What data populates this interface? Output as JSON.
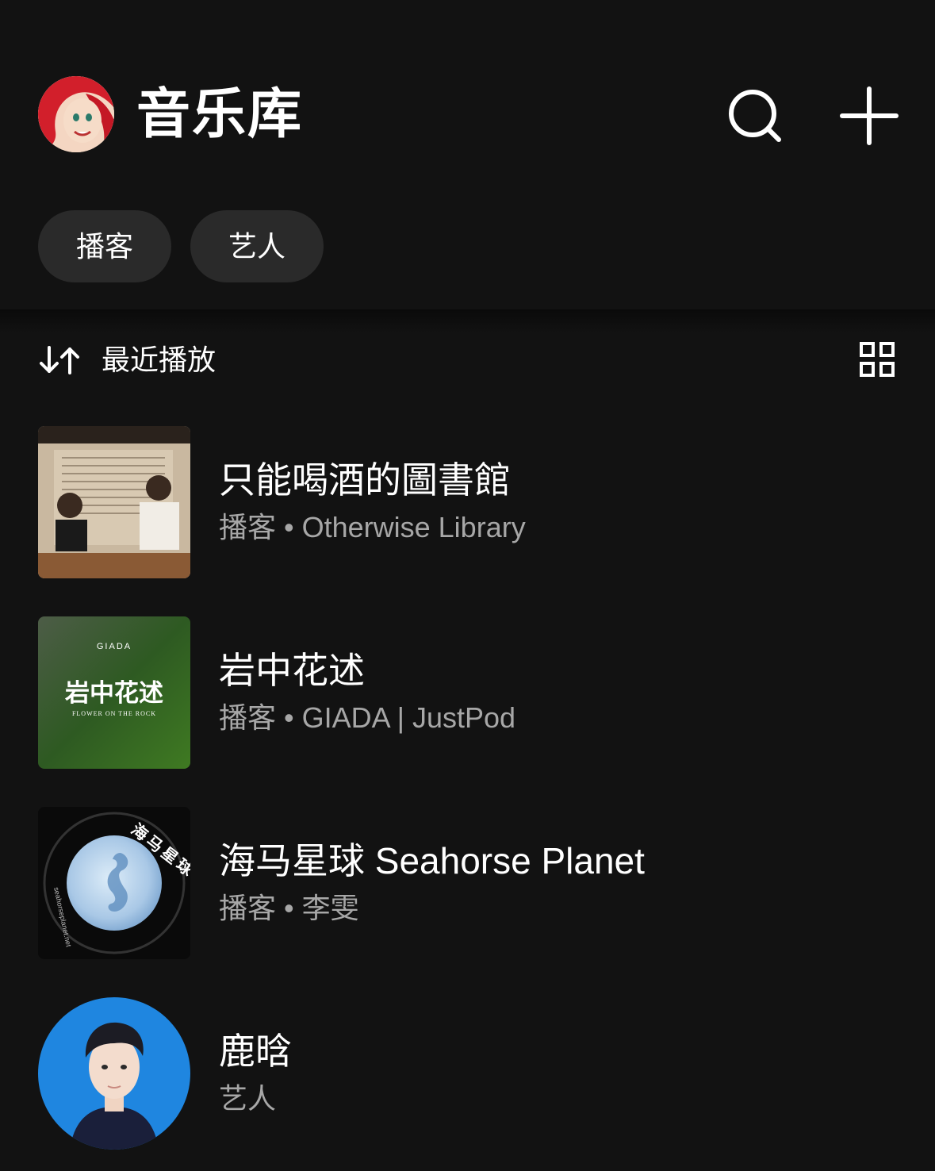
{
  "header": {
    "title": "音乐库",
    "icons": [
      "search-icon",
      "plus-icon"
    ]
  },
  "filters": [
    {
      "label": "播客"
    },
    {
      "label": "艺人"
    }
  ],
  "sort": {
    "label": "最近播放",
    "icon": "sort-arrows-icon",
    "view_icon": "grid-view-icon"
  },
  "library": {
    "items": [
      {
        "title": "只能喝酒的圖書館",
        "subtitle": "播客 • Otherwise Library"
      },
      {
        "title": "岩中花述",
        "subtitle": "播客 • GIADA | JustPod",
        "cover": {
          "brand": "GIADA",
          "title": "岩中花述",
          "subtitle": "FLOWER ON THE ROCK"
        }
      },
      {
        "title": "海马星球 Seahorse Planet",
        "subtitle": "播客 • 李雯",
        "cover": {
          "ring_text": "海马星球",
          "side_text": "seahorseplanet.net"
        }
      },
      {
        "title": "鹿晗",
        "subtitle": "艺人"
      }
    ]
  },
  "colors": {
    "background": "#121212",
    "chip": "#2a2a2a",
    "secondary_text": "#a7a7a7"
  }
}
